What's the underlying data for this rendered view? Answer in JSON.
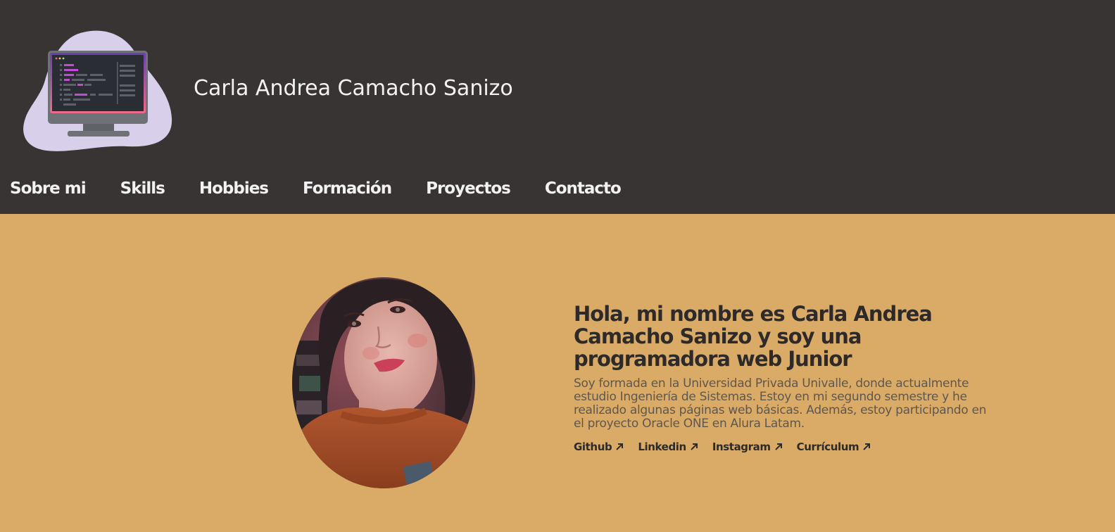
{
  "header": {
    "title": "Carla Andrea Camacho Sanizo",
    "logo_icon": "computer-monitor-code-icon"
  },
  "nav": {
    "items": [
      {
        "label": "Sobre mi"
      },
      {
        "label": "Skills"
      },
      {
        "label": "Hobbies"
      },
      {
        "label": "Formación"
      },
      {
        "label": "Proyectos"
      },
      {
        "label": "Contacto"
      }
    ]
  },
  "hero": {
    "title": "Hola, mi nombre es Carla Andrea Camacho Sanizo y soy una programadora web Junior",
    "description": "Soy formada en la Universidad Privada Univalle, donde actualmente estudio Ingeniería de Sistemas. Estoy en mi segundo semestre y he realizado algunas páginas web básicas. Además, estoy participando en el proyecto Oracle ONE en Alura Latam.",
    "links": [
      {
        "label": "Github",
        "icon": "arrow-up-right-icon"
      },
      {
        "label": "Linkedin",
        "icon": "arrow-up-right-icon"
      },
      {
        "label": "Instagram",
        "icon": "arrow-up-right-icon"
      },
      {
        "label": "Currículum",
        "icon": "arrow-up-right-icon"
      }
    ]
  },
  "colors": {
    "header_bg": "#383434",
    "hero_bg": "#d9ab67",
    "nav_text": "#f2f2f2",
    "title_text": "#2e2a2a",
    "body_text": "#5f574e",
    "logo_blob": "#d8d0ea",
    "code_accent": "#c04cd0"
  }
}
